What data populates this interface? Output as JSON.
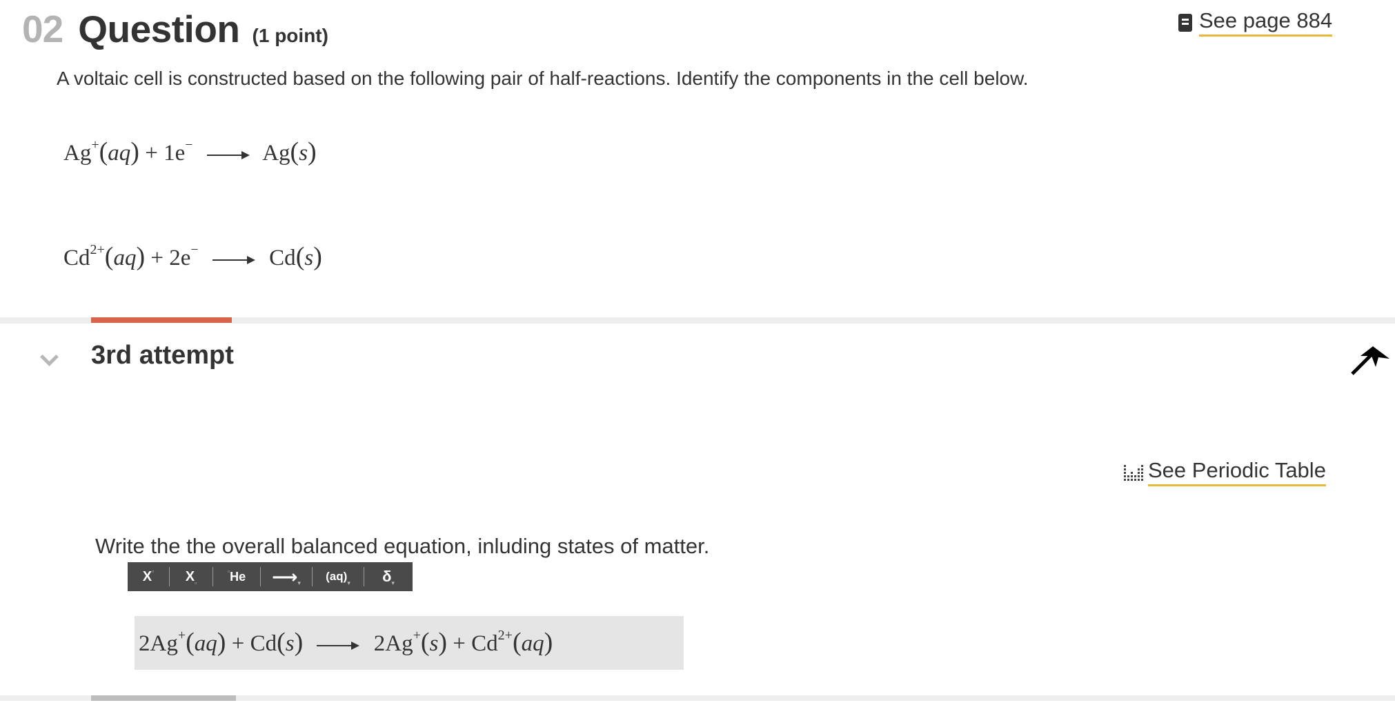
{
  "question": {
    "number": "02",
    "title": "Question",
    "points": "(1 point)",
    "see_page_icon": "book-icon",
    "see_page_label": "See page 884",
    "prompt": "A voltaic cell is constructed based on the following pair of half-reactions. Identify the components in the cell below.",
    "half_reactions": [
      {
        "ion": "Ag",
        "ion_charge": "+",
        "state1": "aq",
        "electrons": "1e",
        "e_charge": "−",
        "product": "Ag",
        "state2": "s"
      },
      {
        "ion": "Cd",
        "ion_charge": "2+",
        "state1": "aq",
        "electrons": "2e",
        "e_charge": "−",
        "product": "Cd",
        "state2": "s"
      }
    ]
  },
  "attempt": {
    "label": "3rd attempt",
    "toggle_icon": "chevron-down-icon",
    "accent_color": "#d9634a"
  },
  "periodic_table": {
    "icon": "periodic-table-icon",
    "label": "See Periodic Table"
  },
  "answer_section": {
    "instruction": "Write the the overall balanced equation, inluding states of matter.",
    "toolbar": {
      "superscript": "X",
      "subscript": "X",
      "element": "He",
      "arrow": "⟶",
      "state": "(aq)",
      "delta": "δ"
    },
    "answer": {
      "coef1": "2Ag",
      "charge1": "+",
      "state1": "aq",
      "reactant2": "Cd",
      "state2": "s",
      "coef3": "2Ag",
      "charge3": "+",
      "state3": "s",
      "product2": "Cd",
      "charge4": "2+",
      "state4": "aq",
      "plus": "+"
    }
  },
  "colors": {
    "link_underline": "#e6b93a",
    "toolbar_bg": "#4a4a4a",
    "answer_bg": "#e5e5e5"
  }
}
